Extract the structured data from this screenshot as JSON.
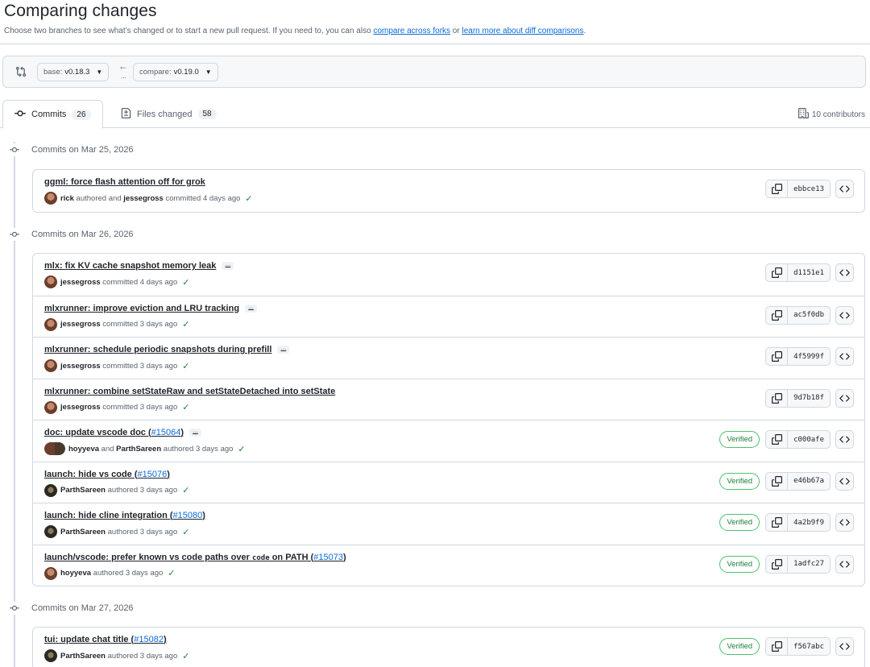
{
  "header": {
    "title": "Comparing changes",
    "subtitle_before": "Choose two branches to see what’s changed or to start a new pull request. If you need to, you can also ",
    "link_forks": "compare across forks",
    "subtitle_or": " or ",
    "link_learn": "learn more about diff comparisons",
    "subtitle_end": "."
  },
  "compare": {
    "base_prefix": "base:",
    "base_value": "v0.18.3",
    "compare_prefix": "compare:",
    "compare_value": "v0.19.0",
    "arrow": "←",
    "dots": "..."
  },
  "tabs": {
    "commits_label": "Commits",
    "commits_count": "26",
    "files_label": "Files changed",
    "files_count": "58",
    "contributors": "10 contributors"
  },
  "groups": [
    {
      "date": "Commits on Mar 25, 2026",
      "commits": [
        {
          "title": "ggml: force flash attention off for grok",
          "pr": "",
          "author": "rick",
          "meta": " authored and ",
          "author2": "jessegross",
          "meta2": " committed 4 days ago",
          "sha": "ebbce13",
          "verified": "",
          "ellipsis": false,
          "avatar": "normal"
        }
      ]
    },
    {
      "date": "Commits on Mar 26, 2026",
      "commits": [
        {
          "title": "mlx: fix KV cache snapshot memory leak",
          "pr": "",
          "author": "jessegross",
          "meta": " committed 4 days ago",
          "author2": "",
          "meta2": "",
          "sha": "d1151e1",
          "verified": "",
          "ellipsis": true,
          "avatar": "normal"
        },
        {
          "title": "mlxrunner: improve eviction and LRU tracking",
          "pr": "",
          "author": "jessegross",
          "meta": " committed 3 days ago",
          "author2": "",
          "meta2": "",
          "sha": "ac5f0db",
          "verified": "",
          "ellipsis": true,
          "avatar": "normal"
        },
        {
          "title": "mlxrunner: schedule periodic snapshots during prefill",
          "pr": "",
          "author": "jessegross",
          "meta": " committed 3 days ago",
          "author2": "",
          "meta2": "",
          "sha": "4f5999f",
          "verified": "",
          "ellipsis": true,
          "avatar": "normal"
        },
        {
          "title": "mlxrunner: combine setStateRaw and setStateDetached into setState",
          "pr": "",
          "author": "jessegross",
          "meta": " committed 3 days ago",
          "author2": "",
          "meta2": "",
          "sha": "9d7b18f",
          "verified": "",
          "ellipsis": false,
          "avatar": "normal"
        },
        {
          "title": "doc: update vscode doc (",
          "pr": "#15064",
          "author": "hoyyeva",
          "meta": " and ",
          "author2": "ParthSareen",
          "meta2": " authored 3 days ago",
          "sha": "c000afe",
          "verified": "Verified",
          "ellipsis": true,
          "avatar": "pair"
        },
        {
          "title": "launch: hide vs code (",
          "pr": "#15076",
          "author": "ParthSareen",
          "meta": " authored 3 days ago",
          "author2": "",
          "meta2": "",
          "sha": "e46b67a",
          "verified": "Verified",
          "ellipsis": false,
          "avatar": "dark"
        },
        {
          "title": "launch: hide cline integration (",
          "pr": "#15080",
          "author": "ParthSareen",
          "meta": " authored 3 days ago",
          "author2": "",
          "meta2": "",
          "sha": "4a2b9f9",
          "verified": "Verified",
          "ellipsis": false,
          "avatar": "dark"
        },
        {
          "title": "launch/vscode: prefer known vs code paths over ",
          "code": "code",
          "title_after": " on PATH (",
          "pr": "#15073",
          "author": "hoyyeva",
          "meta": " authored 3 days ago",
          "author2": "",
          "meta2": "",
          "sha": "1adfc27",
          "verified": "Verified",
          "ellipsis": false,
          "avatar": "normal"
        }
      ]
    },
    {
      "date": "Commits on Mar 27, 2026",
      "commits": [
        {
          "title": "tui: update chat title (",
          "pr": "#15082",
          "author": "ParthSareen",
          "meta": " authored 3 days ago",
          "author2": "",
          "meta2": "",
          "sha": "f567abc",
          "verified": "Verified",
          "ellipsis": false,
          "avatar": "dark"
        }
      ]
    }
  ]
}
